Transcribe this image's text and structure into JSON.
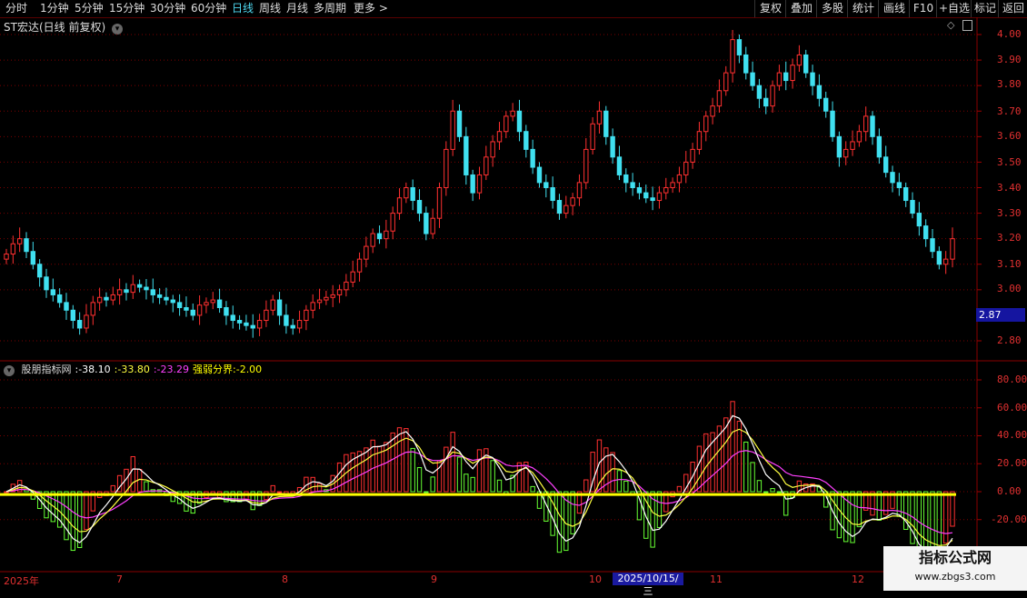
{
  "toolbar": {
    "periods": [
      "分时",
      "1分钟",
      "5分钟",
      "15分钟",
      "30分钟",
      "60分钟",
      "日线",
      "周线",
      "月线",
      "多周期",
      "更多 >"
    ],
    "active_period": "日线",
    "right_tools": [
      "复权",
      "叠加",
      "多股",
      "统计",
      "画线",
      "F10",
      "+自选",
      "标记",
      "返回"
    ]
  },
  "price_panel": {
    "title": "ST宏达(日线 前复权)",
    "y_ticks": [
      "4.00",
      "3.90",
      "3.80",
      "3.70",
      "3.60",
      "3.50",
      "3.40",
      "3.30",
      "3.20",
      "3.10",
      "3.00",
      "2.80"
    ],
    "cursor_price": "2.87"
  },
  "indicator_panel": {
    "name": "股朋指标网",
    "values": [
      {
        "text": ":-38.10",
        "color": "#ffffff"
      },
      {
        "text": ":-33.80",
        "color": "#ffff40"
      },
      {
        "text": ":-23.29",
        "color": "#ff40ff"
      },
      {
        "text": "强弱分界:-2.00",
        "color": "#ffff00"
      }
    ],
    "y_ticks": [
      "80.00",
      "60.00",
      "40.00",
      "20.00",
      "0.00",
      "-20.00"
    ]
  },
  "x_axis": {
    "labels": [
      "2025年",
      "7",
      "8",
      "9",
      "10",
      "11",
      "12"
    ],
    "cursor_date": "2025/10/15/三"
  },
  "watermark": {
    "line1": "指标公式网",
    "line2": "www.zbgs3.com"
  },
  "colors": {
    "up": "#ff3030",
    "down": "#40e0f0",
    "bar_up": "#ff3030",
    "bar_down": "#66ff33",
    "baseline": "#ffff00"
  },
  "chart_data": [
    {
      "type": "candlestick",
      "title": "ST宏达(日线 前复权)",
      "ylim": [
        2.75,
        4.05
      ],
      "close": [
        3.14,
        3.18,
        3.2,
        3.15,
        3.1,
        3.05,
        3.0,
        2.98,
        2.95,
        2.92,
        2.88,
        2.85,
        2.9,
        2.95,
        2.97,
        2.96,
        2.98,
        3.0,
        2.99,
        3.02,
        3.01,
        3.0,
        2.98,
        2.97,
        2.96,
        2.95,
        2.93,
        2.92,
        2.9,
        2.94,
        2.95,
        2.96,
        2.93,
        2.9,
        2.88,
        2.87,
        2.86,
        2.85,
        2.88,
        2.92,
        2.96,
        2.9,
        2.86,
        2.85,
        2.88,
        2.92,
        2.95,
        2.96,
        2.97,
        2.98,
        3.0,
        3.03,
        3.07,
        3.12,
        3.17,
        3.22,
        3.2,
        3.23,
        3.3,
        3.36,
        3.4,
        3.35,
        3.3,
        3.22,
        3.28,
        3.4,
        3.55,
        3.7,
        3.6,
        3.45,
        3.38,
        3.45,
        3.52,
        3.58,
        3.62,
        3.68,
        3.7,
        3.62,
        3.55,
        3.48,
        3.42,
        3.4,
        3.35,
        3.3,
        3.33,
        3.36,
        3.42,
        3.55,
        3.65,
        3.7,
        3.6,
        3.52,
        3.45,
        3.42,
        3.4,
        3.38,
        3.36,
        3.35,
        3.38,
        3.4,
        3.42,
        3.45,
        3.5,
        3.55,
        3.62,
        3.68,
        3.72,
        3.78,
        3.85,
        3.98,
        3.92,
        3.85,
        3.8,
        3.75,
        3.72,
        3.8,
        3.85,
        3.82,
        3.88,
        3.92,
        3.85,
        3.8,
        3.75,
        3.7,
        3.6,
        3.52,
        3.55,
        3.58,
        3.62,
        3.68,
        3.6,
        3.52,
        3.46,
        3.42,
        3.4,
        3.35,
        3.3,
        3.25,
        3.2,
        3.15,
        3.1,
        3.12,
        3.2
      ]
    },
    {
      "type": "bar",
      "title": "股朋指标网",
      "ylim": [
        -38,
        90
      ],
      "baseline": -2.0,
      "x_categories": [
        "2025年",
        "7",
        "8",
        "9",
        "10",
        "11",
        "12"
      ]
    }
  ]
}
